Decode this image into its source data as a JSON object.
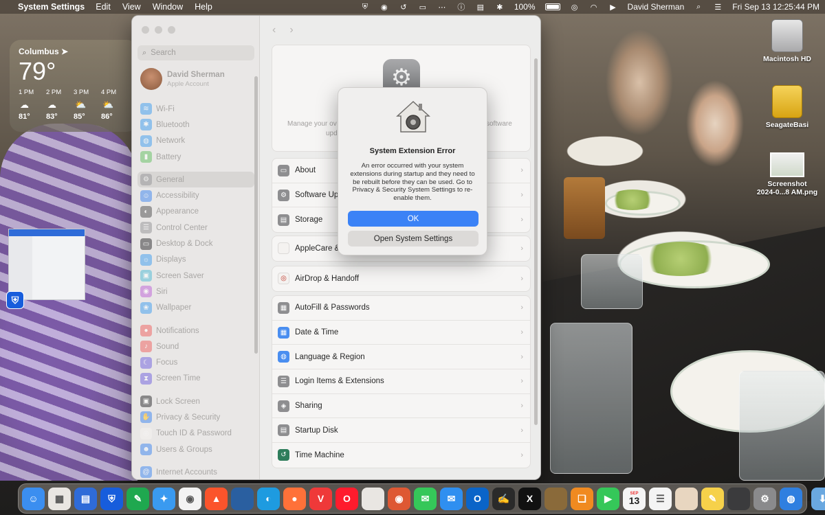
{
  "menubar": {
    "app_name": "System Settings",
    "menus": [
      "Edit",
      "View",
      "Window",
      "Help"
    ],
    "battery_percent": "100%",
    "user": "David Sherman",
    "datetime": "Fri Sep 13  12:25:44 PM"
  },
  "weather": {
    "city": "Columbus",
    "current_temp": "79°",
    "hours": [
      {
        "time": "1 PM",
        "temp": "81°",
        "icon": "cloud-icon"
      },
      {
        "time": "2 PM",
        "temp": "83°",
        "icon": "cloud-icon"
      },
      {
        "time": "3 PM",
        "temp": "85°",
        "icon": "partly-sunny-icon"
      },
      {
        "time": "4 PM",
        "temp": "86°",
        "icon": "partly-sunny-icon"
      }
    ]
  },
  "desktop_icons": {
    "hd": "Macintosh HD",
    "seagate": "SeagateBasi",
    "screenshot_line1": "Screenshot",
    "screenshot_line2": "2024-0...8 AM.png"
  },
  "settings": {
    "search_placeholder": "Search",
    "account": {
      "name": "David Sherman",
      "subtitle": "Apple Account"
    },
    "sidebar": {
      "network": [
        {
          "label": "Wi-Fi",
          "color": "#4aa3f0",
          "icon": "wifi-icon"
        },
        {
          "label": "Bluetooth",
          "color": "#4aa3f0",
          "icon": "bluetooth-icon"
        },
        {
          "label": "Network",
          "color": "#4aa3f0",
          "icon": "globe-icon"
        },
        {
          "label": "Battery",
          "color": "#6cc36c",
          "icon": "battery-icon"
        }
      ],
      "system": [
        {
          "label": "General",
          "color": "#9a9a9c",
          "icon": "gear-icon",
          "selected": true
        },
        {
          "label": "Accessibility",
          "color": "#4a8ef0",
          "icon": "accessibility-icon"
        },
        {
          "label": "Appearance",
          "color": "#5a5a5c",
          "icon": "appearance-icon"
        },
        {
          "label": "Control Center",
          "color": "#9a9a9c",
          "icon": "control-center-icon"
        },
        {
          "label": "Desktop & Dock",
          "color": "#3a3a3c",
          "icon": "dock-icon"
        },
        {
          "label": "Displays",
          "color": "#4aa3f0",
          "icon": "displays-icon"
        },
        {
          "label": "Screen Saver",
          "color": "#5bbfd6",
          "icon": "screen-saver-icon"
        },
        {
          "label": "Siri",
          "color": "#c06ad8",
          "icon": "siri-icon"
        },
        {
          "label": "Wallpaper",
          "color": "#4aa3f0",
          "icon": "wallpaper-icon"
        }
      ],
      "attention": [
        {
          "label": "Notifications",
          "color": "#f06a6a",
          "icon": "notifications-icon"
        },
        {
          "label": "Sound",
          "color": "#f06a6a",
          "icon": "sound-icon"
        },
        {
          "label": "Focus",
          "color": "#7a6ae0",
          "icon": "focus-icon"
        },
        {
          "label": "Screen Time",
          "color": "#7a6ae0",
          "icon": "screen-time-icon"
        }
      ],
      "security": [
        {
          "label": "Lock Screen",
          "color": "#3a3a3c",
          "icon": "lock-icon"
        },
        {
          "label": "Privacy & Security",
          "color": "#4a8ef0",
          "icon": "hand-icon"
        },
        {
          "label": "Touch ID & Password",
          "color": "#f4f2f0",
          "icon": "fingerprint-icon"
        },
        {
          "label": "Users & Groups",
          "color": "#4a8ef0",
          "icon": "users-icon"
        }
      ],
      "accounts": [
        {
          "label": "Internet Accounts",
          "color": "#4a8ef0",
          "icon": "at-icon"
        }
      ]
    },
    "hero": {
      "desc_left": "Manage your ov",
      "desc_left2": "upd",
      "desc_right": "software"
    },
    "groups": [
      [
        {
          "label": "About",
          "color": "#8e8e90",
          "icon": "about-icon"
        },
        {
          "label": "Software Upd",
          "color": "#8e8e90",
          "icon": "software-update-icon"
        },
        {
          "label": "Storage",
          "color": "#8e8e90",
          "icon": "storage-icon"
        }
      ],
      [
        {
          "label": "AppleCare &",
          "color": "#f4f2f0",
          "icon": "apple-icon"
        }
      ],
      [
        {
          "label": "AirDrop & Handoff",
          "color": "#f4f2f0",
          "icon": "airdrop-icon"
        }
      ],
      [
        {
          "label": "AutoFill & Passwords",
          "color": "#8e8e90",
          "icon": "autofill-icon"
        },
        {
          "label": "Date & Time",
          "color": "#4a8ef0",
          "icon": "calendar-icon"
        },
        {
          "label": "Language & Region",
          "color": "#4a8ef0",
          "icon": "globe-icon"
        },
        {
          "label": "Login Items & Extensions",
          "color": "#8e8e90",
          "icon": "list-icon"
        },
        {
          "label": "Sharing",
          "color": "#8e8e90",
          "icon": "sharing-icon"
        },
        {
          "label": "Startup Disk",
          "color": "#8e8e90",
          "icon": "disk-icon"
        },
        {
          "label": "Time Machine",
          "color": "#2e7d5b",
          "icon": "time-machine-icon"
        }
      ]
    ]
  },
  "dialog": {
    "title": "System Extension Error",
    "message": "An error occurred with your system extensions during startup and they need to be rebuilt before they can be used. Go to Privacy & Security System Settings to re-enable them.",
    "ok_label": "OK",
    "open_label": "Open System Settings"
  },
  "dock": {
    "apps": [
      {
        "name": "finder-icon",
        "color": "#3b8ef0"
      },
      {
        "name": "launchpad-icon",
        "color": "#e9e6e2"
      },
      {
        "name": "files-icon",
        "color": "#2f6bd8"
      },
      {
        "name": "bitwarden-icon",
        "color": "#175ddc"
      },
      {
        "name": "evernote-icon",
        "color": "#1fa84f"
      },
      {
        "name": "safari-icon",
        "color": "#3a9af0"
      },
      {
        "name": "chrome-icon",
        "color": "#f3f3f3"
      },
      {
        "name": "brave-icon",
        "color": "#fb542b"
      },
      {
        "name": "network-radar-icon",
        "color": "#2a5fa0"
      },
      {
        "name": "edge-icon",
        "color": "#1e9be0"
      },
      {
        "name": "firefox-icon",
        "color": "#ff7139"
      },
      {
        "name": "vivaldi-icon",
        "color": "#ef3939"
      },
      {
        "name": "opera-icon",
        "color": "#ff1b2d"
      },
      {
        "name": "mars-edit-icon",
        "color": "#e9e6e2"
      },
      {
        "name": "duckduckgo-icon",
        "color": "#de5833"
      },
      {
        "name": "messages-icon",
        "color": "#35c759"
      },
      {
        "name": "mail-icon",
        "color": "#2f8ff0"
      },
      {
        "name": "outlook-icon",
        "color": "#0a64c8"
      },
      {
        "name": "reader-icon",
        "color": "#2a2a2a"
      },
      {
        "name": "x-icon",
        "color": "#111111"
      },
      {
        "name": "books-shelf-icon",
        "color": "#8a6a3a"
      },
      {
        "name": "books-icon",
        "color": "#f08a20"
      },
      {
        "name": "facetime-icon",
        "color": "#35c759"
      },
      {
        "name": "calendar-icon",
        "color": "#f4f4f4"
      },
      {
        "name": "reminders-icon",
        "color": "#f4f4f4"
      },
      {
        "name": "paint-icon",
        "color": "#e8d6c0"
      },
      {
        "name": "notes-icon",
        "color": "#f6d14a"
      },
      {
        "name": "iphone-mirroring-icon",
        "color": "#3b3b3d"
      },
      {
        "name": "system-settings-icon",
        "color": "#8a8a8c"
      },
      {
        "name": "network-icon",
        "color": "#2f7fe0"
      }
    ],
    "calendar_month": "SEP",
    "calendar_day": "13",
    "trailing": [
      {
        "name": "downloads-folder-icon",
        "color": "#6aa8e0"
      },
      {
        "name": "trash-icon",
        "color": "#d8d8da"
      }
    ]
  }
}
